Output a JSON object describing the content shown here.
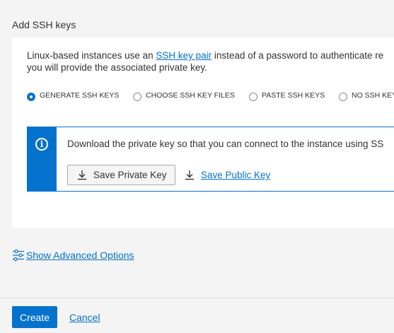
{
  "section": {
    "title": "Add SSH keys"
  },
  "description": {
    "before_link": "Linux-based instances use an ",
    "link": "SSH key pair",
    "after_link": " instead of a password to authenticate re",
    "line2": "you will provide the associated private key."
  },
  "ssh_options": {
    "selected": "GENERATE SSH KEYS",
    "items": [
      {
        "label": "GENERATE SSH KEYS"
      },
      {
        "label": "CHOOSE SSH KEY FILES"
      },
      {
        "label": "PASTE SSH KEYS"
      },
      {
        "label": "NO SSH KEY"
      }
    ]
  },
  "info": {
    "icon": "info-icon",
    "message": "Download the private key so that you can connect to the instance using SS",
    "save_private_label": "Save Private Key",
    "save_public_label": "Save Public Key"
  },
  "advanced": {
    "label": "Show Advanced Options"
  },
  "footer": {
    "create_label": "Create",
    "cancel_label": "Cancel"
  },
  "colors": {
    "accent": "#0572ce",
    "background": "#f4f4f4",
    "card": "#ffffff"
  }
}
